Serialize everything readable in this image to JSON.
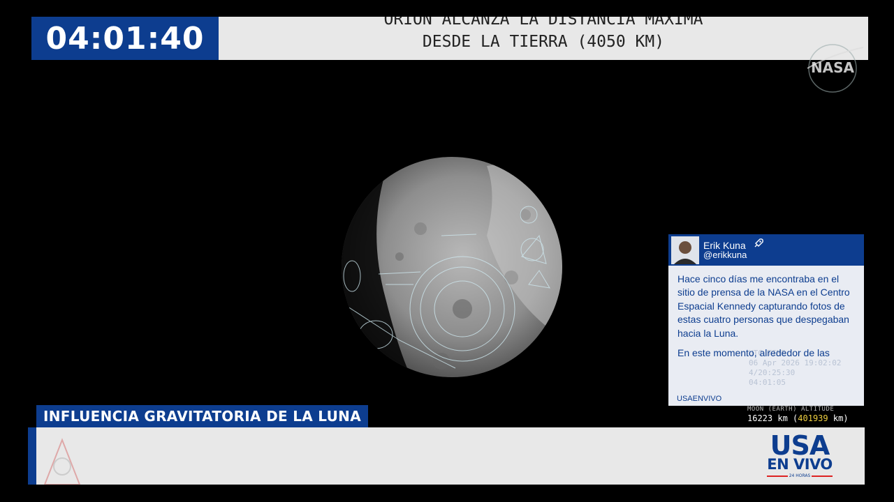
{
  "broadcast": {
    "clock": "04:01:40",
    "headline": [
      "ORION ALCANZA LA DISTANCIA MAXIMA",
      "DESDE LA TIERRA (4050 KM)"
    ],
    "logo": "NASA",
    "lower_third": "INFLUENCIA GRAVITATORIA DE LA LUNA"
  },
  "tweet": {
    "name": "Erik Kuna",
    "handle": "@erikkuna",
    "icon": "rocket-icon",
    "paragraphs": [
      "Hace cinco días me encontraba en el sitio de prensa de la NASA en el Centro Espacial Kennedy capturando fotos de estas cuatro personas que despegaban hacia la Luna.",
      "En este momento, alrededor de las"
    ],
    "source": "USAENVIVO"
  },
  "background_telemetry": [
    "UTC TIME",
    "06 Apr 2026 19:02:02",
    "4/20:25:30",
    "04:01:05"
  ],
  "telemetry": {
    "label": "MOON (EARTH) ALTITUDE",
    "value_km": "16223",
    "unit1": "km",
    "value_earth_km": "401939",
    "unit2": "km"
  },
  "brand": {
    "line1": "USA",
    "line2": "EN VIVO",
    "line3": "24 HORAS"
  },
  "colors": {
    "accent_blue": "#0d3d8f",
    "banner_gray": "#e8e8e8",
    "highlight_yellow": "#f0d040"
  }
}
